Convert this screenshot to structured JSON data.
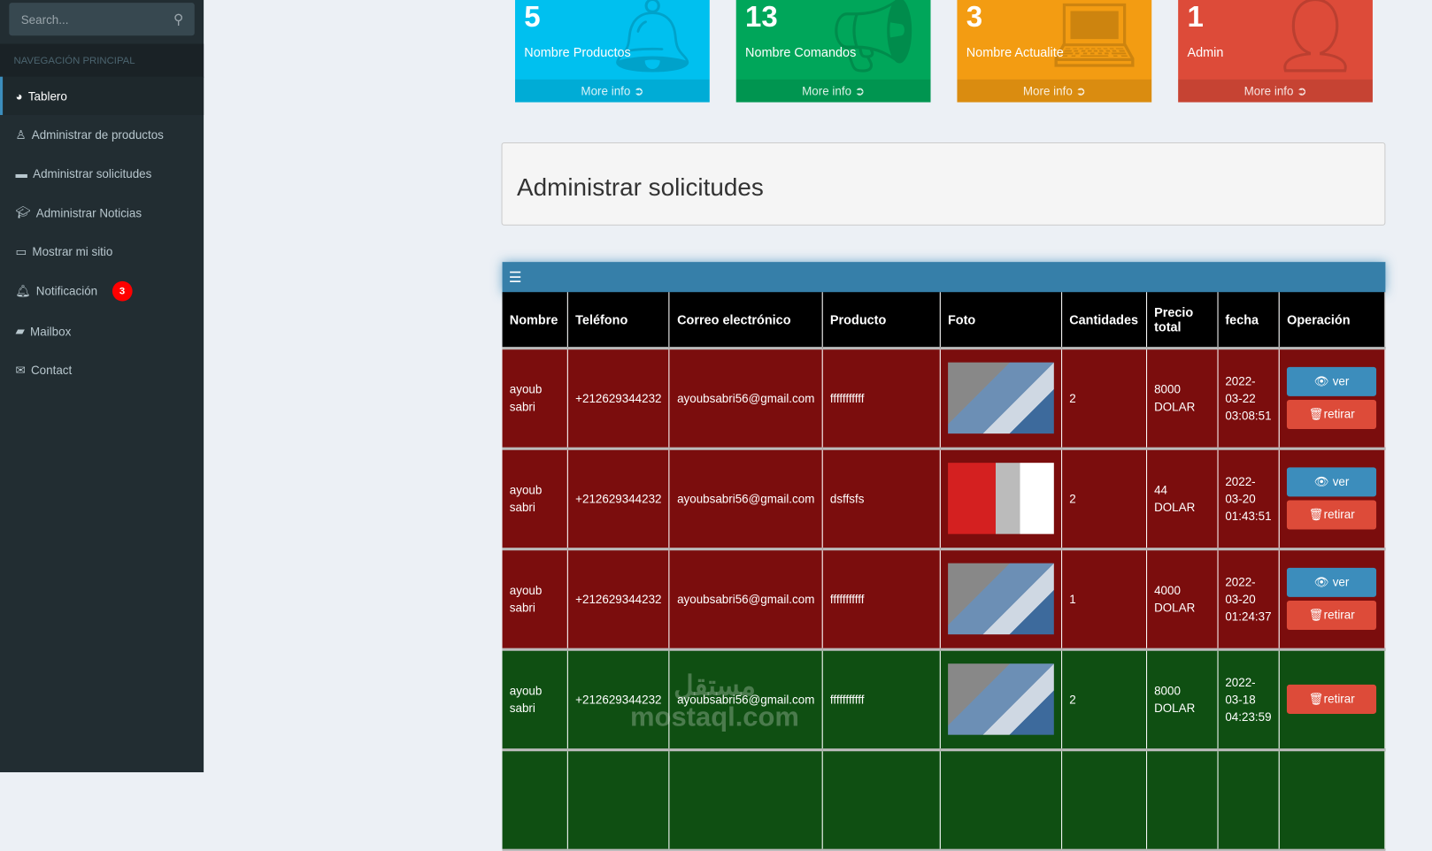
{
  "sidebar": {
    "search_placeholder": "Search...",
    "nav_header": "NAVEGACIÓN PRINCIPAL",
    "items": [
      {
        "label": "Tablero",
        "icon": "dashboard-icon"
      },
      {
        "label": "Administrar de productos",
        "icon": "user-md-icon"
      },
      {
        "label": "Administrar solicitudes",
        "icon": "briefcase-icon"
      },
      {
        "label": "Administrar Noticias",
        "icon": "graduation-cap-icon"
      },
      {
        "label": "Mostrar mi sitio",
        "icon": "desktop-icon"
      },
      {
        "label": "Notificación",
        "icon": "bell-icon",
        "badge": "3"
      },
      {
        "label": "Mailbox",
        "icon": "folder-icon"
      },
      {
        "label": "Contact",
        "icon": "envelope-icon"
      }
    ]
  },
  "stats": [
    {
      "value": "5",
      "label": "Nombre Productos",
      "more": "More info",
      "color": "#00c0ef",
      "icon": "bell-icon"
    },
    {
      "value": "13",
      "label": "Nombre Comandos",
      "more": "More info",
      "color": "#00a65a",
      "icon": "bullhorn-icon"
    },
    {
      "value": "3",
      "label": "Nombre Actualite",
      "more": "More info",
      "color": "#f39c12",
      "icon": "laptop-icon"
    },
    {
      "value": "1",
      "label": "Admin",
      "more": "More info",
      "color": "#dd4b39",
      "icon": "user-icon"
    }
  ],
  "panel_title": "Administrar solicitudes",
  "table": {
    "headers": [
      "Nombre",
      "Teléfono",
      "Correo electrónico",
      "Producto",
      "Foto",
      "Cantidades",
      "Precio total",
      "fecha",
      "Operación"
    ],
    "ver_label": "ver",
    "retirar_label": "retirar",
    "rows": [
      {
        "status": "red",
        "nombre": "ayoub sabri",
        "telefono": "+212629344232",
        "correo": "ayoubsabri56@gmail.com",
        "producto": "fffffffffff",
        "cantidad": "2",
        "precio": "8000 DOLAR",
        "fecha": "2022-03-22 03:08:51",
        "ver": true
      },
      {
        "status": "red",
        "nombre": "ayoub sabri",
        "telefono": "+212629344232",
        "correo": "ayoubsabri56@gmail.com",
        "producto": "dsffsfs",
        "cantidad": "2",
        "precio": "44 DOLAR",
        "fecha": "2022-03-20 01:43:51",
        "ver": true
      },
      {
        "status": "red",
        "nombre": "ayoub sabri",
        "telefono": "+212629344232",
        "correo": "ayoubsabri56@gmail.com",
        "producto": "fffffffffff",
        "cantidad": "1",
        "precio": "4000 DOLAR",
        "fecha": "2022-03-20 01:24:37",
        "ver": true
      },
      {
        "status": "green",
        "nombre": "ayoub sabri",
        "telefono": "+212629344232",
        "correo": "ayoubsabri56@gmail.com",
        "producto": "fffffffffff",
        "cantidad": "2",
        "precio": "8000 DOLAR",
        "fecha": "2022-03-18 04:23:59",
        "ver": false
      }
    ]
  },
  "watermark": "مستقل mostaql.com"
}
